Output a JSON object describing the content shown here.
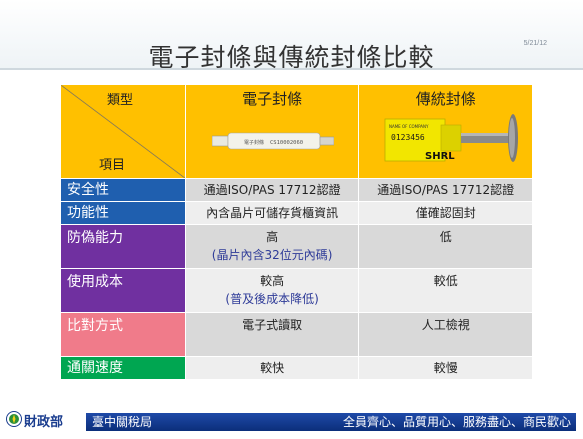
{
  "slide": {
    "title": "電子封條與傳統封條比較",
    "date": "5/21/12"
  },
  "table": {
    "header": {
      "corner_top": "類型",
      "corner_bottom": "項目",
      "col_electronic": "電子封條",
      "col_traditional": "傳統封條"
    },
    "seal_electronic_print": "CS10002060",
    "seal_traditional_code": "0123456",
    "seal_traditional_brand": "SHRL",
    "rows": [
      {
        "label": "安全性",
        "label_color": "#1f5faf",
        "electronic": "通過ISO/PAS 17712認證",
        "electronic_sub": "",
        "traditional": "通過ISO/PAS 17712認證"
      },
      {
        "label": "功能性",
        "label_color": "#1f5faf",
        "electronic": "內含晶片可儲存貨櫃資訊",
        "electronic_sub": "",
        "traditional": "僅確認固封"
      },
      {
        "label": "防偽能力",
        "label_color": "#7030a0",
        "electronic": "高",
        "electronic_sub": "(晶片內含32位元內碼)",
        "traditional": "低"
      },
      {
        "label": "使用成本",
        "label_color": "#7030a0",
        "electronic": "較高",
        "electronic_sub": "(普及後成本降低)",
        "traditional": "較低"
      },
      {
        "label": "比對方式",
        "label_color": "#f07b8a",
        "electronic": "電子式讀取",
        "electronic_sub": "",
        "traditional": "人工檢視"
      },
      {
        "label": "通關速度",
        "label_color": "#00a651",
        "electronic": "較快",
        "electronic_sub": "",
        "traditional": "較慢"
      }
    ]
  },
  "footer": {
    "org": "財政部",
    "bureau": "臺中關稅局",
    "slogan": "全員齊心、品質用心、服務盡心、商民歡心",
    "band_color": "#1a3d8f"
  }
}
